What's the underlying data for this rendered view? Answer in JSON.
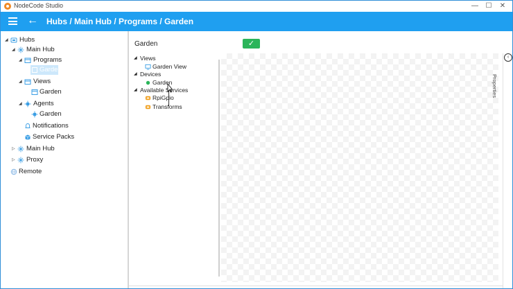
{
  "window": {
    "app_title": "NodeCode Studio",
    "minimize_glyph": "—",
    "maximize_glyph": "☐",
    "close_glyph": "✕"
  },
  "header": {
    "menu_icon": "hamburger-icon",
    "back_icon": "back-arrow-icon",
    "breadcrumb": "Hubs / Main Hub / Programs / Garden",
    "color": "#1f9ff0"
  },
  "tree": {
    "hubs": "Hubs",
    "main_hub": "Main Hub",
    "programs": "Programs",
    "programs_garden": "Garden",
    "views": "Views",
    "views_garden": "Garden",
    "agents": "Agents",
    "agents_garden": "Garden",
    "notifications": "Notifications",
    "service_packs": "Service Packs",
    "main_hub_2": "Main Hub",
    "proxy": "Proxy",
    "remote": "Remote"
  },
  "editor": {
    "program_name": "Garden",
    "confirm_glyph": "✓",
    "confirm_color": "#2bb55a"
  },
  "source_tree": {
    "views": "Views",
    "garden_view": "Garden View",
    "devices": "Devices",
    "garden": "Garden",
    "available_services": "Available Services",
    "rpigpio": "RpiGpio",
    "transforms": "Transforms"
  },
  "properties": {
    "label": "Properties",
    "toggle_glyph": "‹"
  }
}
